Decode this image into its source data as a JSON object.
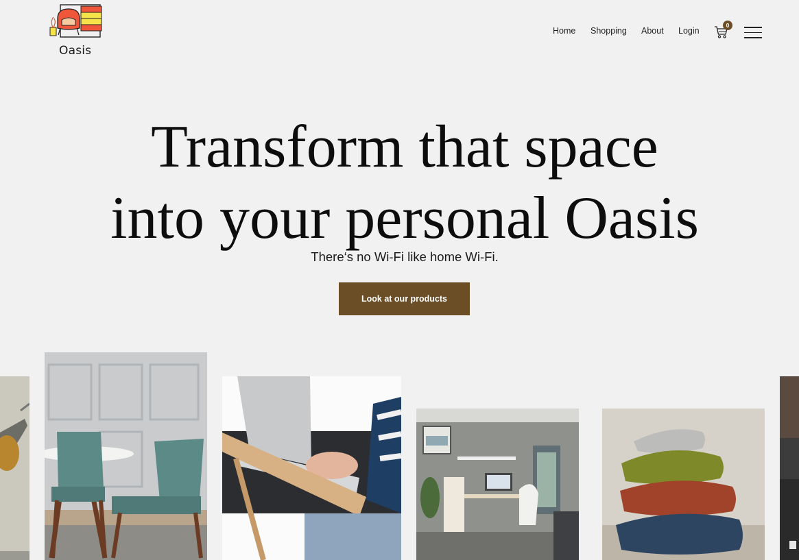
{
  "brand": {
    "name": "Oasis"
  },
  "nav": {
    "items": [
      {
        "label": "Home"
      },
      {
        "label": "Shopping"
      },
      {
        "label": "About"
      },
      {
        "label": "Login"
      }
    ],
    "cart_count": "0"
  },
  "hero": {
    "headline_line1": "Transform that space",
    "headline_line2": "into your personal Oasis",
    "subline": "There‘s no Wi-Fi like home Wi-Fi.",
    "cta_label": "Look at our products"
  },
  "colors": {
    "accent": "#6b4e26",
    "background": "#f1f1f1"
  },
  "gallery": [
    {
      "icon": "desk-lamp-image"
    },
    {
      "icon": "dining-chairs-image"
    },
    {
      "icon": "laptop-tray-image"
    },
    {
      "icon": "home-office-image"
    },
    {
      "icon": "stacked-pillows-image"
    },
    {
      "icon": "dark-furniture-image"
    }
  ]
}
